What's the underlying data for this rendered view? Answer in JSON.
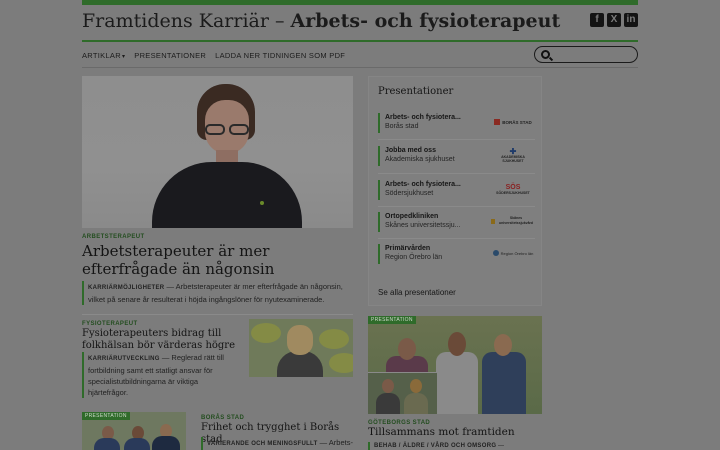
{
  "masthead": {
    "title_light": "Framtidens Karriär – ",
    "title_bold": "Arbets- och fysioterapeut",
    "social_icons": [
      "facebook-icon",
      "x-icon",
      "linkedin-icon"
    ]
  },
  "nav": {
    "items": [
      "ARTIKLAR",
      "PRESENTATIONER",
      "LADDA NER TIDNINGEN SOM PDF"
    ],
    "search_placeholder": ""
  },
  "hero": {
    "kicker": "ARBETSTERAPEUT",
    "title": "Arbetsterapeuter är mer efterfrågade än någonsin",
    "excerpt_label": "KARRIÄRMÖJLIGHETER",
    "excerpt_text": " — Arbetsterapeuter är mer efterfrågade än någonsin, vilket på senare år resulterat i höjda ingångslöner för nyutexaminerade."
  },
  "article2": {
    "kicker": "FYSIOTERAPEUT",
    "title": "Fysioterapeuters bidrag till folkhälsan bör värderas högre",
    "excerpt_label": "KARRIÄRUTVECKLING",
    "excerpt_text": " — Reglerad rätt till fortbildning samt ett statligt ansvar för specialistutbildningarna är viktiga hjärtefrågor."
  },
  "presentations": {
    "title": "Presentationer",
    "items": [
      {
        "name": "Arbets- och fysiotera...",
        "org": "Borås stad",
        "logo": "BORÅS STAD"
      },
      {
        "name": "Jobba med oss",
        "org": "Akademiska sjukhuset",
        "logo": "AKADEMISKA SJUKHUSET"
      },
      {
        "name": "Arbets- och fysiotera...",
        "org": "Södersjukhuset",
        "logo": "SÖDERSJUKHUSET"
      },
      {
        "name": "Ortopedkliniken",
        "org": "Skånes universitetssju...",
        "logo": "Skånes universitetssjukvård"
      },
      {
        "name": "Primärvården",
        "org": "Region Örebro län",
        "logo": "Region Örebro län"
      }
    ],
    "see_all": "Se alla presentationer"
  },
  "feature_right": {
    "tag": "PRESENTATION",
    "kicker": "GÖTEBORGS STAD",
    "title": "Tillsammans mot framtiden",
    "excerpt_label": "BEHAB / ÄLDRE / VÅRD OCH OMSORG",
    "excerpt_text": " —"
  },
  "feature_left": {
    "tag": "PRESENTATION",
    "kicker": "BORÅS STAD",
    "title": "Frihet och trygghet i Borås stad",
    "excerpt_label": "VARIERANDE OCH MENINGSFULLT",
    "excerpt_text": " — Arbets- och"
  },
  "colors": {
    "accent_green": "#2f6b2a",
    "overlay_gray": "#7c7c7c"
  }
}
